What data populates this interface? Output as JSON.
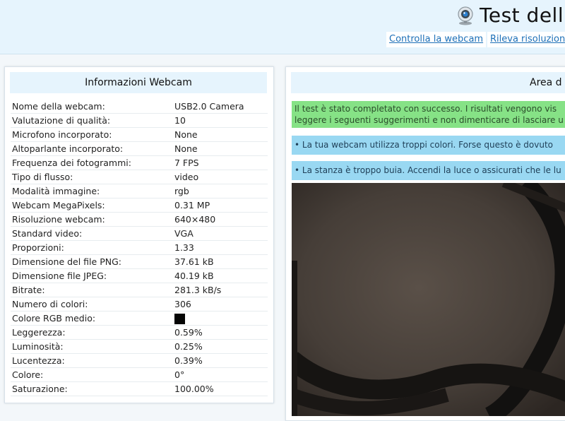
{
  "header": {
    "title": "Test dell",
    "icon": "webcam-icon",
    "links": [
      "Controlla la webcam",
      "Rileva risoluzione"
    ]
  },
  "info_panel": {
    "title": "Informazioni Webcam",
    "rows": [
      {
        "label": "Nome della webcam:",
        "value": "USB2.0 Camera"
      },
      {
        "label": "Valutazione di qualità:",
        "value": "10"
      },
      {
        "label": "Microfono incorporato:",
        "value": "None"
      },
      {
        "label": "Altoparlante incorporato:",
        "value": "None"
      },
      {
        "label": "Frequenza dei fotogrammi:",
        "value": "7 FPS"
      },
      {
        "label": "Tipo di flusso:",
        "value": "video"
      },
      {
        "label": "Modalità immagine:",
        "value": "rgb"
      },
      {
        "label": "Webcam MegaPixels:",
        "value": "0.31 MP"
      },
      {
        "label": "Risoluzione webcam:",
        "value": "640×480"
      },
      {
        "label": "Standard video:",
        "value": "VGA"
      },
      {
        "label": "Proporzioni:",
        "value": "1.33"
      },
      {
        "label": "Dimensione del file PNG:",
        "value": "37.61 kB"
      },
      {
        "label": "Dimensione file JPEG:",
        "value": "40.19 kB"
      },
      {
        "label": "Bitrate:",
        "value": "281.3 kB/s"
      },
      {
        "label": "Numero di colori:",
        "value": "306"
      },
      {
        "label": "Colore RGB medio:",
        "value": "",
        "swatch": "#050505"
      },
      {
        "label": "Leggerezza:",
        "value": "0.59%"
      },
      {
        "label": "Luminosità:",
        "value": "0.25%"
      },
      {
        "label": "Lucentezza:",
        "value": "0.39%"
      },
      {
        "label": "Colore:",
        "value": "0°"
      },
      {
        "label": "Saturazione:",
        "value": "100.00%"
      }
    ]
  },
  "area_panel": {
    "title": "Area d",
    "messages": {
      "success_line1": "Il test è stato completato con successo. I risultati vengono vis",
      "success_line2": "leggere i seguenti suggerimenti e non dimenticare di lasciare u",
      "info1": "• La tua webcam utilizza troppi colori. Forse questo è dovuto",
      "info2": "• La stanza è troppo buia. Accendi la luce o assicurati che le lu"
    }
  },
  "colors": {
    "header_bg": "#e6f4fd",
    "success_bg": "#86e286",
    "info_bg": "#99d8f2",
    "link": "#1c6fb7"
  }
}
